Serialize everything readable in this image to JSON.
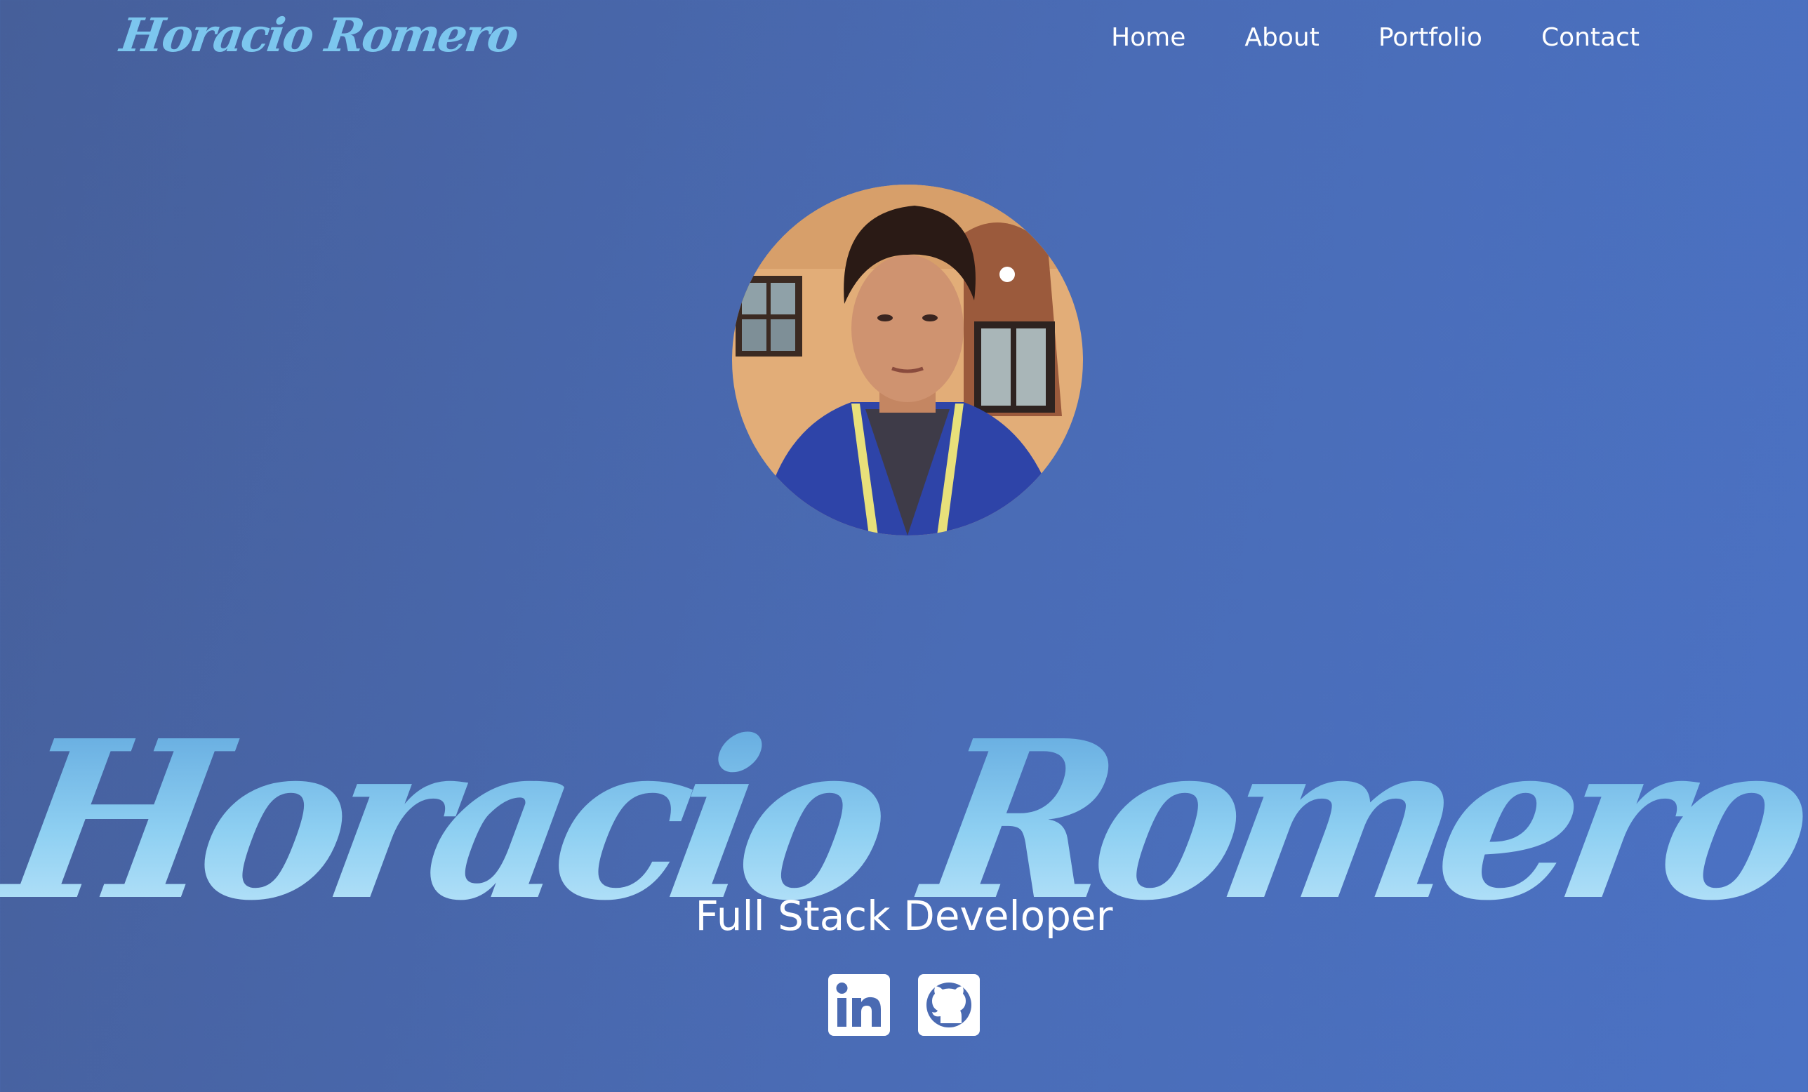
{
  "header": {
    "brand": "Horacio Romero",
    "nav": [
      {
        "label": "Home"
      },
      {
        "label": "About"
      },
      {
        "label": "Portfolio"
      },
      {
        "label": "Contact"
      }
    ]
  },
  "hero": {
    "avatar_icon": "profile-photo",
    "name": "Horacio Romero",
    "role": "Full Stack Developer"
  },
  "socials": [
    {
      "icon": "linkedin-icon"
    },
    {
      "icon": "github-icon"
    }
  ],
  "colors": {
    "background": "#4a6ab2",
    "brand_accent": "#7cc6ee",
    "text": "#ffffff"
  }
}
